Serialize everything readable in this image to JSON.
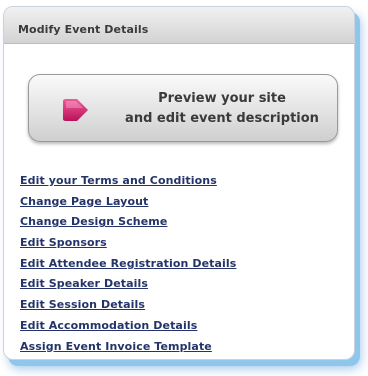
{
  "panel": {
    "title": "Modify Event Details"
  },
  "preview_button": {
    "line1": "Preview your site",
    "line2": "and edit event description",
    "icon": "arrow-right-icon",
    "icon_color": "#d4246f"
  },
  "links": [
    {
      "label": "Edit your Terms and Conditions"
    },
    {
      "label": "Change Page Layout"
    },
    {
      "label": "Change Design Scheme"
    },
    {
      "label": "Edit Sponsors"
    },
    {
      "label": "Edit Attendee Registration Details"
    },
    {
      "label": "Edit Speaker Details"
    },
    {
      "label": "Edit Session Details"
    },
    {
      "label": "Edit Accommodation Details"
    },
    {
      "label": "Assign Event Invoice Template"
    }
  ],
  "colors": {
    "link": "#24346a",
    "panel_shadow": "#8fc6ec"
  }
}
